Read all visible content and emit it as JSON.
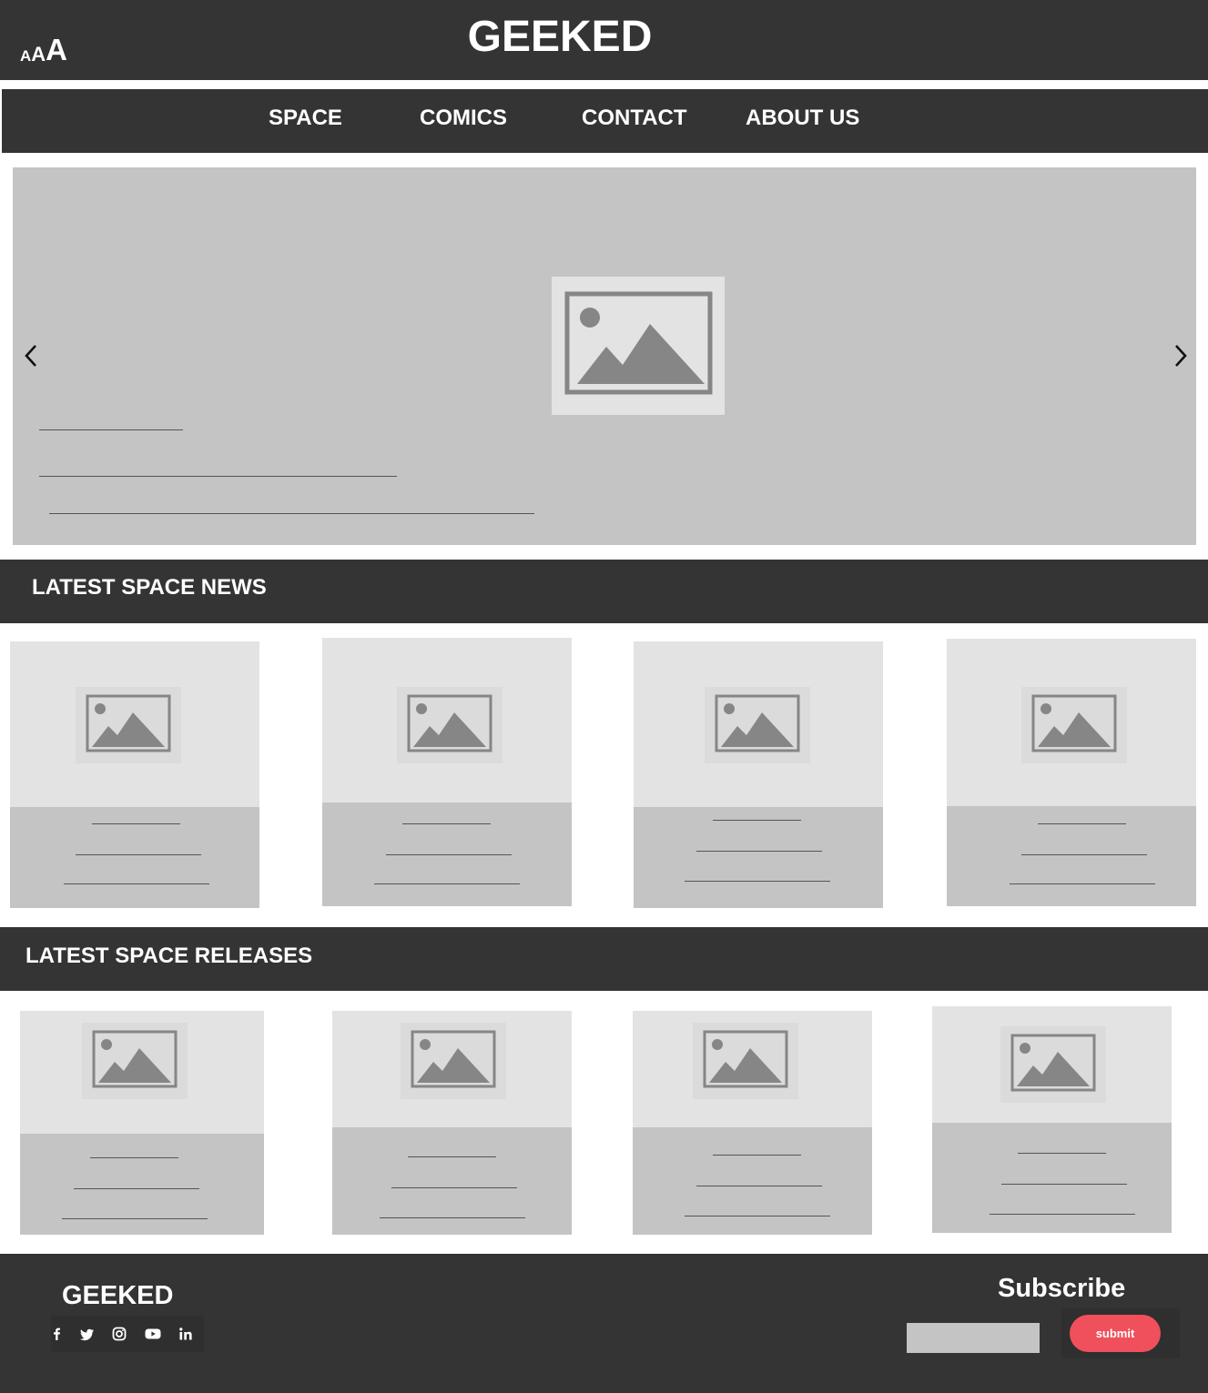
{
  "header": {
    "font_size_control": [
      "A",
      "A",
      "A"
    ],
    "title": "GEEKED"
  },
  "nav": {
    "items": [
      "SPACE",
      "COMICS",
      "CONTACT",
      "ABOUT US"
    ]
  },
  "sections": {
    "news_title": "LATEST SPACE NEWS",
    "releases_title": "LATEST SPACE RELEASES"
  },
  "footer": {
    "logo": "GEEKED",
    "social_icons": [
      "facebook-icon",
      "twitter-icon",
      "instagram-icon",
      "youtube-icon",
      "linkedin-icon"
    ],
    "subscribe_title": "Subscribe",
    "email_placeholder": "",
    "submit_label": "submit"
  },
  "colors": {
    "dark_bar": "#353435",
    "placeholder_gray": "#c4c4c4",
    "image_bg": "#e3e3e3",
    "icon_gray": "#868686",
    "submit": "#f0505b"
  }
}
